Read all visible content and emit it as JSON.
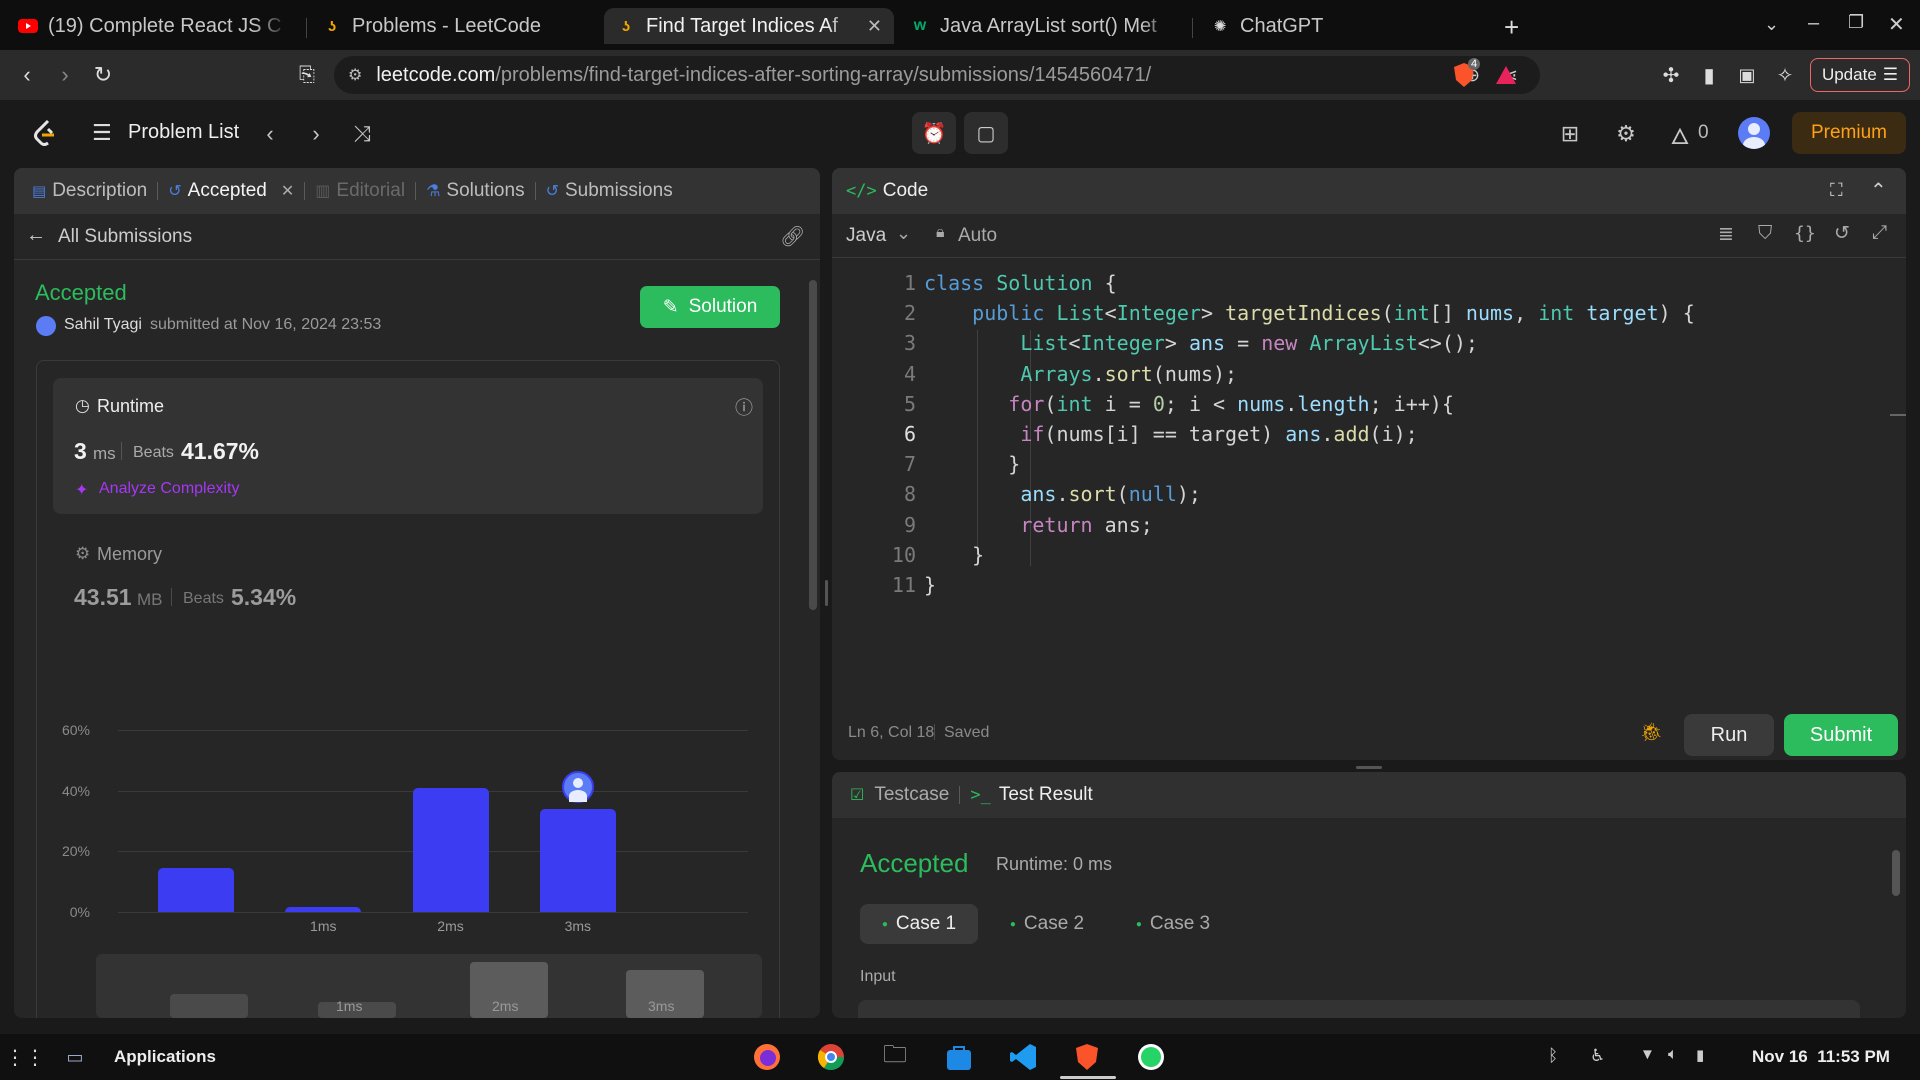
{
  "browser": {
    "tabs": [
      {
        "title": "(19) Complete React JS C",
        "favicon": "youtube-icon",
        "active": false
      },
      {
        "title": "Problems - LeetCode",
        "favicon": "leetcode-icon",
        "active": false
      },
      {
        "title": "Find Target Indices Af",
        "favicon": "leetcode-icon",
        "active": true
      },
      {
        "title": "Java ArrayList sort() Met",
        "favicon": "w3schools-icon",
        "active": false
      },
      {
        "title": "ChatGPT",
        "favicon": "chatgpt-icon",
        "active": false
      }
    ],
    "url_host": "leetcode.com",
    "url_path": "/problems/find-target-indices-after-sorting-array/submissions/1454560471/",
    "update_label": "Update",
    "shield_badge": "4"
  },
  "header": {
    "problem_list": "Problem List",
    "streak": "0",
    "premium": "Premium"
  },
  "left": {
    "tabs": {
      "description": "Description",
      "accepted": "Accepted",
      "editorial": "Editorial",
      "solutions": "Solutions",
      "submissions": "Submissions"
    },
    "all_submissions": "All Submissions",
    "status": "Accepted",
    "user": "Sahil Tyagi",
    "submitted_at": "submitted at Nov 16, 2024 23:53",
    "solution_btn": "Solution",
    "runtime": {
      "label": "Runtime",
      "value": "3",
      "unit": "ms",
      "beats_label": "Beats",
      "beats": "41.67%",
      "analyze": "Analyze Complexity"
    },
    "memory": {
      "label": "Memory",
      "value": "43.51",
      "unit": "MB",
      "beats_label": "Beats",
      "beats": "5.34%"
    }
  },
  "chart_data": {
    "type": "bar",
    "categories": [
      "",
      "1ms",
      "2ms",
      "3ms"
    ],
    "values": [
      14.5,
      1.7,
      41,
      33.8
    ],
    "ylim": [
      0,
      60
    ],
    "yticks": [
      "0%",
      "20%",
      "40%",
      "60%"
    ],
    "highlight_category": "3ms",
    "bar_color": "#3c3cf2",
    "grid": true
  },
  "mini_chart": {
    "labels": [
      "1ms",
      "2ms",
      "3ms"
    ]
  },
  "editor": {
    "title": "Code",
    "language": "Java",
    "mode": "Auto",
    "status_pos": "Ln 6, Col 18",
    "status_saved": "Saved",
    "run": "Run",
    "submit": "Submit",
    "line_numbers": [
      "1",
      "2",
      "3",
      "4",
      "5",
      "6",
      "7",
      "8",
      "9",
      "10",
      "11"
    ]
  },
  "testpanel": {
    "testcase_tab": "Testcase",
    "result_tab": "Test Result",
    "status": "Accepted",
    "runtime": "Runtime: 0 ms",
    "cases": [
      "Case 1",
      "Case 2",
      "Case 3"
    ],
    "input_label": "Input"
  },
  "taskbar": {
    "applications": "Applications",
    "datetime": "Nov 16  11:53 PM"
  }
}
